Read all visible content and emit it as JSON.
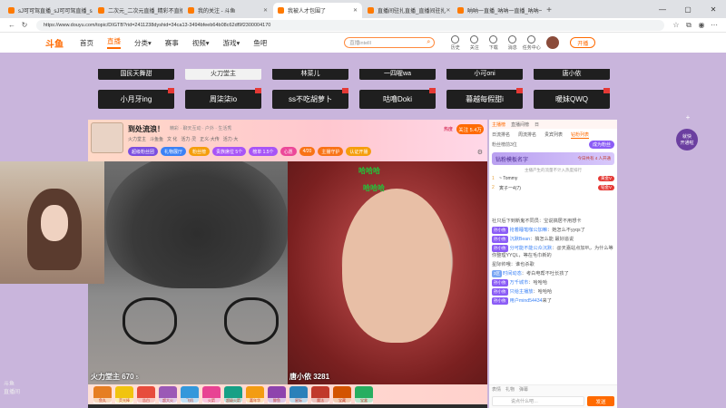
{
  "browser": {
    "tabs": [
      {
        "title": "sJ可可驾直播_sJ可可驾直播_sJ可"
      },
      {
        "title": "二次元_二次元直播_精彩不直播"
      },
      {
        "title": "我的关注 - 斗鱼"
      },
      {
        "title": "我被人才包围了"
      },
      {
        "title": "直播间驻扎直播_直播间驻扎"
      },
      {
        "title": "呐呐一直播_呐呐一直播_呐呐一"
      }
    ],
    "new_tab": "+",
    "url": "https://www.douyu.com/topic/DIGTB?rid=2411238dyshid=34ca13-3494bfeeb64b08c62df9f2300004170"
  },
  "site": {
    "logo": "斗鱼",
    "nav": [
      "首页",
      "直播",
      "分类▾",
      "赛事",
      "视频▾",
      "游戏▾",
      "鱼吧"
    ],
    "search_placeholder": "直播intelll",
    "header_icons": [
      "历史",
      "关注",
      "下载",
      "消息",
      "任务中心"
    ],
    "start_live": "开播"
  },
  "names": {
    "row0": [
      "国民天舞甜",
      "火刀堂主",
      "林菜儿",
      "一四喔wa",
      "小可oni",
      "唐小依"
    ],
    "row1": [
      "小月牙ing",
      "周柒柒io",
      "ss不吃胡萝卜",
      "咕噜Doki",
      "暮越每假甜i",
      "暖妹QWQ"
    ]
  },
  "room": {
    "title": "到处流浪！",
    "meta": "精彩 · 聊天互动 · 户外 · 生活秀",
    "tags": [
      "火力堂主",
      "斗鱼鱼",
      "文 化",
      "活力·灵",
      "正义·大传",
      "活力·大"
    ],
    "chips": [
      {
        "label": "超级粉丝团",
        "color": "#7b4fe0"
      },
      {
        "label": "礼物展厅",
        "color": "#3b82f6"
      },
      {
        "label": "粉丝榜",
        "color": "#f59e0b"
      },
      {
        "label": "贵族席位 5个",
        "color": "#a855f7"
      },
      {
        "label": "榜单 1.5个",
        "color": "#a855f7"
      },
      {
        "label": "心愿",
        "color": "#ec4899"
      },
      {
        "label": "4/20",
        "color": "#f97316"
      },
      {
        "label": "主播守护",
        "color": "#f97316"
      },
      {
        "label": "认证开播",
        "color": "#f59e0b"
      }
    ],
    "hot": "热度",
    "follow": "关注 5.4万"
  },
  "video": {
    "left_name": "火力堂主",
    "left_score": "670",
    "left_suffix": "5",
    "right_name": "唐小依",
    "right_score": "3281",
    "overlay1": "哈哈哈",
    "overlay2": "哈哈哈",
    "watermark": "斗鱼\n直播间"
  },
  "gifts": [
    "鱼丸",
    "荧光棒",
    "告白",
    "超大火",
    "飞机",
    "火箭",
    "超级火箭",
    "嘉年华",
    "鲸鱼",
    "星际",
    "魔法",
    "宝藏",
    "宝盒"
  ],
  "chat": {
    "rank_tabs": [
      "主播榜",
      "直播间榜",
      "日"
    ],
    "sub_tabs": [
      "日流排名",
      "周流排名",
      "贵宾列表",
      "钻粉列表"
    ],
    "fans_label": "粉丝榜前3位",
    "fans_btn": "成为粉丝",
    "top_fan": "钻粉模板名字",
    "top_fan_hint": "今日共有 4 人开通",
    "note": "主播产生的流量不计入热度排行",
    "ranks": [
      {
        "rank": "1",
        "name": "~ Tommy",
        "level": "黄金V"
      },
      {
        "rank": "2",
        "name": "寅子一4(7)",
        "level": "铂金V"
      }
    ],
    "messages": [
      {
        "text": "社只后下到新鬼不同员：宝说搞居不用想卡"
      },
      {
        "level": "孙小依",
        "user": "抢着睡笔咖公加嘛",
        "text": "：她怎么不yyqs了"
      },
      {
        "level": "孙小依",
        "user": "沉默Bean",
        "text": "：搞怎么能 最好追说"
      },
      {
        "level": "孙小依",
        "user": "分可能不能公众沉默",
        "text": "：@天嘉站点加叭，为什么等你整理YYQL，等在毛巾新的"
      },
      {
        "text": "星际帅哦：谁也杀歌"
      },
      {
        "level": "3区",
        "user": "时间动态",
        "text": "：考白电帮不吐长孩了"
      },
      {
        "level": "孙小依",
        "user": "万千城市",
        "text": "：哈哈哈"
      },
      {
        "level": "孙小依",
        "user": "只给主播放",
        "text": "：哈哈哈"
      },
      {
        "level": "孙小依",
        "user": "用户mind54434",
        "text": "来了"
      }
    ],
    "tools": [
      "表情",
      "礼物",
      "弹幕"
    ],
    "input_placeholder": "说点什么吧…",
    "send": "发送"
  },
  "float_btn": "就快\n开通啦",
  "colors": {
    "accent": "#ff6a00",
    "page_bg": "#c9b5dc",
    "dark_btn": "#1f1f1f"
  }
}
